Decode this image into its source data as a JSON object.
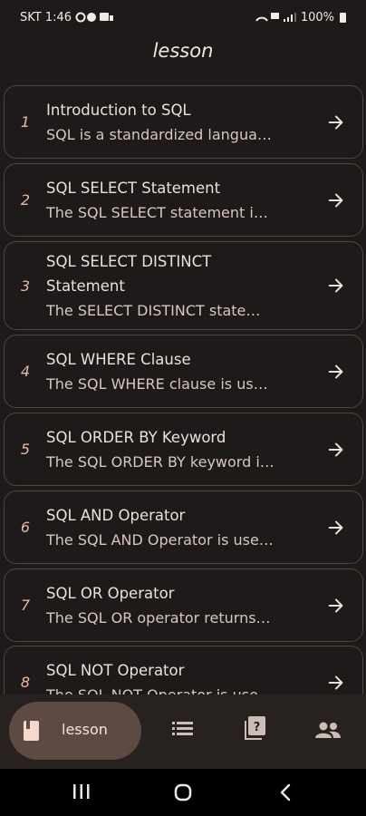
{
  "status_bar": {
    "carrier_time": "SKT 1:46",
    "battery": "100%"
  },
  "header": {
    "title": "lesson"
  },
  "lessons": [
    {
      "number": "1",
      "title": "Introduction to SQL",
      "description": "SQL is a standardized langua…"
    },
    {
      "number": "2",
      "title": "SQL SELECT Statement",
      "description": "The SQL SELECT statement i…"
    },
    {
      "number": "3",
      "title": "SQL SELECT DISTINCT Statement",
      "description": "The SELECT DISTINCT state…"
    },
    {
      "number": "4",
      "title": "SQL WHERE Clause",
      "description": "The SQL WHERE clause is us…"
    },
    {
      "number": "5",
      "title": "SQL ORDER BY Keyword",
      "description": "The SQL ORDER BY keyword i…"
    },
    {
      "number": "6",
      "title": "SQL AND Operator",
      "description": "The SQL AND Operator is use…"
    },
    {
      "number": "7",
      "title": "SQL OR Operator",
      "description": "The SQL OR operator returns …"
    },
    {
      "number": "8",
      "title": "SQL NOT Operator",
      "description": "The SQL NOT Operator is use…"
    }
  ],
  "bottom_nav": {
    "items": [
      {
        "label": "lesson",
        "icon": "book-icon",
        "active": true
      },
      {
        "icon": "list-icon"
      },
      {
        "icon": "quiz-icon"
      },
      {
        "icon": "people-icon"
      }
    ]
  },
  "colors": {
    "background": "#1e1a19",
    "accent": "#e4b9a6",
    "active_pill": "#5c4a43",
    "card_border": "#4f4542"
  }
}
